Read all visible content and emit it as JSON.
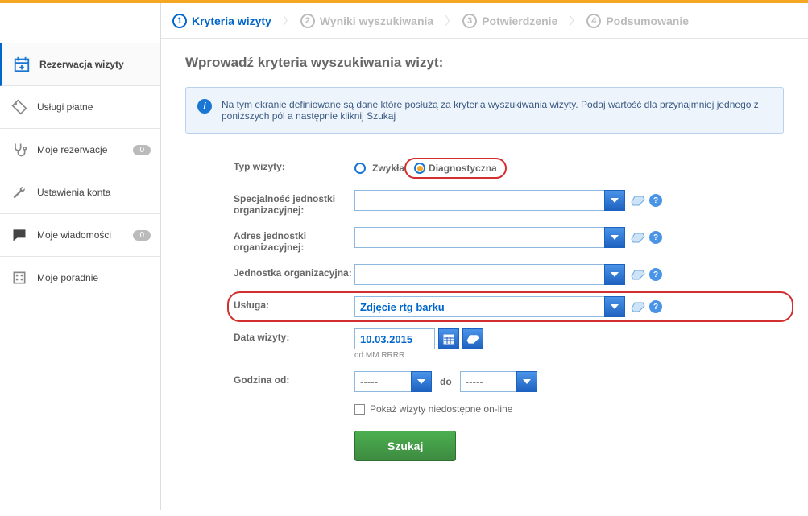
{
  "sidebar": {
    "items": [
      {
        "label": "Rezerwacja wizyty"
      },
      {
        "label": "Usługi płatne"
      },
      {
        "label": "Moje rezerwacje",
        "badge": "0"
      },
      {
        "label": "Ustawienia konta"
      },
      {
        "label": "Moje wiadomości",
        "badge": "0"
      },
      {
        "label": "Moje poradnie"
      }
    ]
  },
  "steps": [
    {
      "num": "1",
      "label": "Kryteria wizyty"
    },
    {
      "num": "2",
      "label": "Wyniki wyszukiwania"
    },
    {
      "num": "3",
      "label": "Potwierdzenie"
    },
    {
      "num": "4",
      "label": "Podsumowanie"
    }
  ],
  "heading": "Wprowadź kryteria wyszukiwania wizyt:",
  "info": "Na tym ekranie definiowane są dane które posłużą za kryteria wyszukiwania wizyty. Podaj wartość dla przynajmniej jednego z poniższych pól a następnie kliknij Szukaj",
  "form": {
    "visit_type_label": "Typ wizyty:",
    "visit_type_regular": "Zwykła",
    "visit_type_diagnostic": "Diagnostyczna",
    "speciality_label": "Specjalność jednostki organizacyjnej:",
    "address_label": "Adres jednostki organizacyjnej:",
    "unit_label": "Jednostka organizacyjna:",
    "service_label": "Usługa:",
    "service_value": "Zdjęcie rtg barku",
    "date_label": "Data wizyty:",
    "date_value": "10.03.2015",
    "date_hint": "dd.MM.RRRR",
    "hour_from_label": "Godzina od:",
    "hour_from_value": "-----",
    "hour_to_label": "do",
    "hour_to_value": "-----",
    "unavailable_label": "Pokaż wizyty niedostępne on-line",
    "search_button": "Szukaj"
  }
}
